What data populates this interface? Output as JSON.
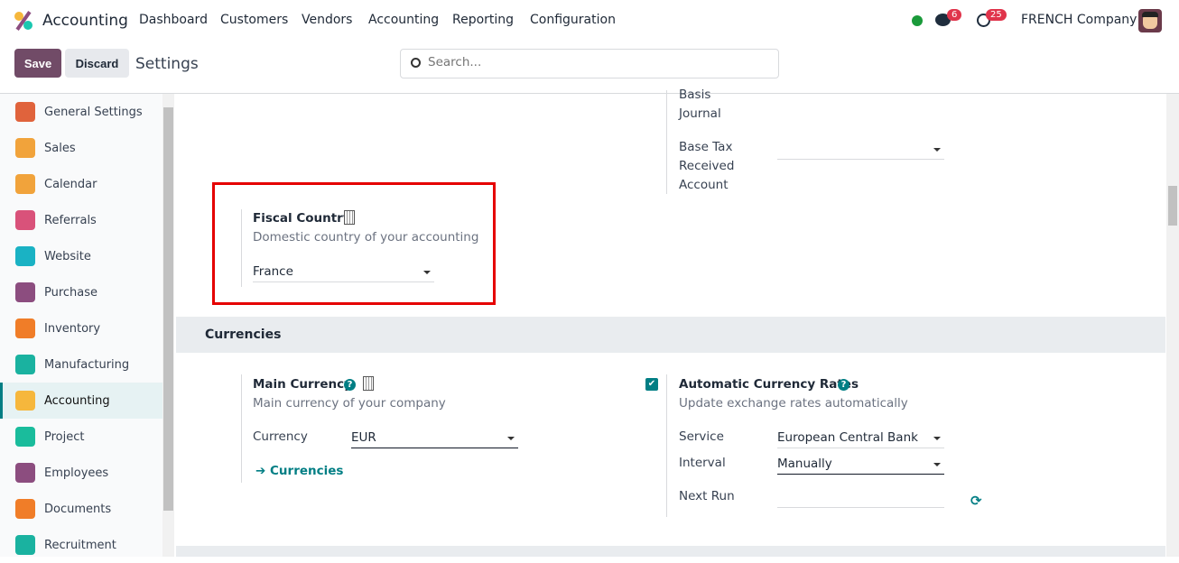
{
  "navbar": {
    "app_name": "Accounting",
    "menu": [
      "Dashboard",
      "Customers",
      "Vendors",
      "Accounting",
      "Reporting",
      "Configuration"
    ],
    "messages_count": "6",
    "activities_count": "25",
    "company": "FRENCH Company",
    "status_color": "#1a9a3a"
  },
  "control": {
    "save": "Save",
    "discard": "Discard",
    "breadcrumb": "Settings",
    "search_placeholder": "Search..."
  },
  "sidebar": {
    "items": [
      {
        "label": "General Settings",
        "color": "#e0633c"
      },
      {
        "label": "Sales",
        "color": "#f1a33b"
      },
      {
        "label": "Calendar",
        "color": "#f1a33b"
      },
      {
        "label": "Referrals",
        "color": "#d9527a"
      },
      {
        "label": "Website",
        "color": "#1ab2c4"
      },
      {
        "label": "Purchase",
        "color": "#8c4d7f"
      },
      {
        "label": "Inventory",
        "color": "#f07d28"
      },
      {
        "label": "Manufacturing",
        "color": "#1ab2a0"
      },
      {
        "label": "Accounting",
        "color": "#f6b73c",
        "active": true
      },
      {
        "label": "Project",
        "color": "#1abc9c"
      },
      {
        "label": "Employees",
        "color": "#8c4d7f"
      },
      {
        "label": "Documents",
        "color": "#f07d28"
      },
      {
        "label": "Recruitment",
        "color": "#1ab2a0"
      }
    ]
  },
  "taxes": {
    "basis_journal_label_1": "Basis",
    "basis_journal_label_2": "Journal",
    "base_tax_label_1": "Base Tax",
    "base_tax_label_2": "Received",
    "base_tax_label_3": "Account",
    "base_tax_value": ""
  },
  "fiscal": {
    "title": "Fiscal Country",
    "description": "Domestic country of your accounting",
    "value": "France",
    "highlight_color": "#e50000"
  },
  "currencies": {
    "section_title": "Currencies",
    "main": {
      "title": "Main Currency",
      "description": "Main currency of your company",
      "currency_label": "Currency",
      "currency_value": "EUR",
      "link": "Currencies"
    },
    "auto": {
      "checked": true,
      "title": "Automatic Currency Rates",
      "description": "Update exchange rates automatically",
      "service_label": "Service",
      "service_value": "European Central Bank",
      "interval_label": "Interval",
      "interval_value": "Manually",
      "next_run_label": "Next Run",
      "next_run_value": ""
    }
  }
}
